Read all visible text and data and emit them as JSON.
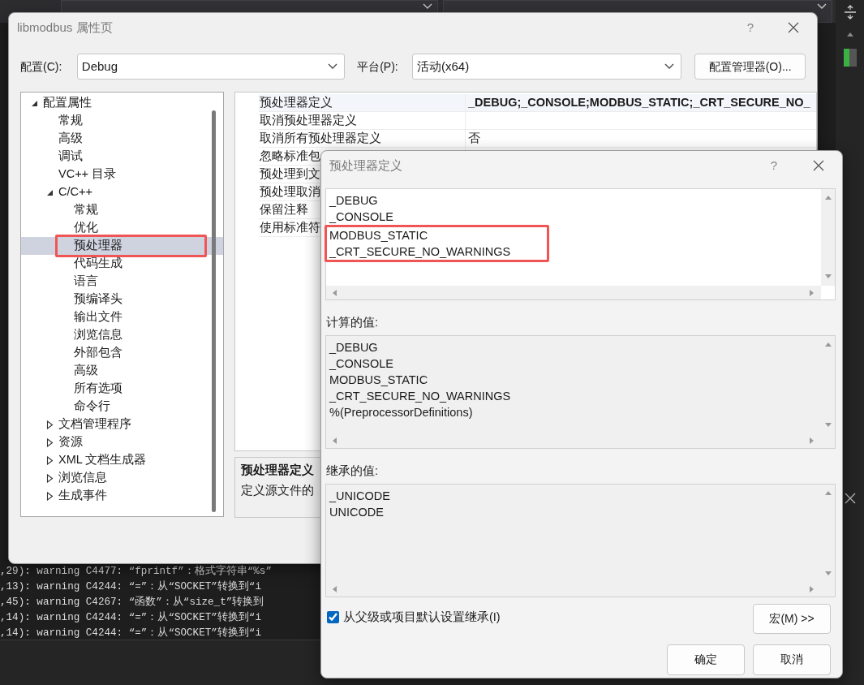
{
  "ide": {
    "output_lines": [
      ",29): warning C4477: “fprintf”：格式字符串“%s”",
      ",13): warning C4244: “=”：从“SOCKET”转换到“i",
      ",45): warning C4267: “函数”：从“size_t”转换到",
      ",14): warning C4244: “=”：从“SOCKET”转换到“i",
      ",14): warning C4244: “=”：从“SOCKET”转换到“i"
    ]
  },
  "property_pages": {
    "title": "libmodbus 属性页",
    "help": "?",
    "config_label": "配置(C):",
    "config_value": "Debug",
    "platform_label": "平台(P):",
    "platform_value": "活动(x64)",
    "manager_button": "配置管理器(O)...",
    "tree": [
      {
        "label": "配置属性",
        "expanded": true,
        "selected": false,
        "annotated": false,
        "children": [
          {
            "label": "常规",
            "selected": false,
            "annotated": false
          },
          {
            "label": "高级",
            "selected": false,
            "annotated": false
          },
          {
            "label": "调试",
            "selected": false,
            "annotated": false
          },
          {
            "label": "VC++ 目录",
            "selected": false,
            "annotated": false
          },
          {
            "label": "C/C++",
            "expanded": true,
            "selected": false,
            "annotated": false,
            "children": [
              {
                "label": "常规",
                "selected": false,
                "annotated": false
              },
              {
                "label": "优化",
                "selected": false,
                "annotated": false
              },
              {
                "label": "预处理器",
                "selected": true,
                "annotated": true
              },
              {
                "label": "代码生成",
                "selected": false,
                "annotated": false
              },
              {
                "label": "语言",
                "selected": false,
                "annotated": false
              },
              {
                "label": "预编译头",
                "selected": false,
                "annotated": false
              },
              {
                "label": "输出文件",
                "selected": false,
                "annotated": false
              },
              {
                "label": "浏览信息",
                "selected": false,
                "annotated": false
              },
              {
                "label": "外部包含",
                "selected": false,
                "annotated": false
              },
              {
                "label": "高级",
                "selected": false,
                "annotated": false
              },
              {
                "label": "所有选项",
                "selected": false,
                "annotated": false
              },
              {
                "label": "命令行",
                "selected": false,
                "annotated": false
              }
            ]
          },
          {
            "label": "文档管理程序",
            "expanded": false,
            "selected": false,
            "annotated": false
          },
          {
            "label": "资源",
            "expanded": false,
            "selected": false,
            "annotated": false
          },
          {
            "label": "XML 文档生成器",
            "expanded": false,
            "selected": false,
            "annotated": false
          },
          {
            "label": "浏览信息",
            "expanded": false,
            "selected": false,
            "annotated": false
          },
          {
            "label": "生成事件",
            "expanded": false,
            "selected": false,
            "annotated": false
          }
        ]
      }
    ],
    "properties": [
      {
        "name": "预处理器定义",
        "value": "_DEBUG;_CONSOLE;MODBUS_STATIC;_CRT_SECURE_NO_",
        "selected": true
      },
      {
        "name": "取消预处理器定义",
        "selected": false
      },
      {
        "name": "取消所有预处理器定义",
        "value": "否",
        "selected": false
      },
      {
        "name": "忽略标准包",
        "selected": false
      },
      {
        "name": "预处理到文",
        "selected": false
      },
      {
        "name": "预处理取消",
        "selected": false
      },
      {
        "name": "保留注释",
        "selected": false
      },
      {
        "name": "使用标准符",
        "selected": false
      }
    ],
    "description": {
      "title": "预处理器定义",
      "text": "定义源文件的"
    }
  },
  "definitions_dialog": {
    "title": "预处理器定义",
    "help": "?",
    "edit_lines": [
      {
        "text": "_DEBUG",
        "annotated": false
      },
      {
        "text": "_CONSOLE",
        "annotated": false
      },
      {
        "text": "MODBUS_STATIC",
        "annotated": true
      },
      {
        "text": "_CRT_SECURE_NO_WARNINGS",
        "annotated": true
      }
    ],
    "evaluated_label": "计算的值:",
    "evaluated_lines": [
      "_DEBUG",
      "_CONSOLE",
      "MODBUS_STATIC",
      "_CRT_SECURE_NO_WARNINGS",
      "%(PreprocessorDefinitions)"
    ],
    "inherited_label": "继承的值:",
    "inherited_lines": [
      "_UNICODE",
      "UNICODE"
    ],
    "inherit_checkbox": {
      "label": "从父级或项目默认设置继承(I)",
      "checked": true
    },
    "macros_button": "宏(M) >>",
    "ok_button": "确定",
    "cancel_button": "取消"
  }
}
